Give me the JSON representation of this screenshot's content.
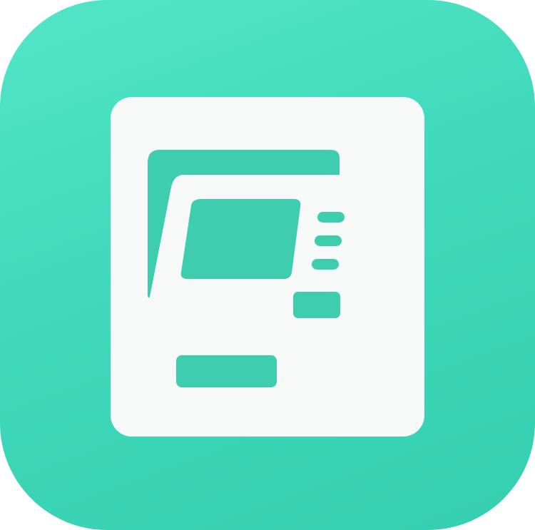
{
  "icon": {
    "name": "atm-machine-icon",
    "colors": {
      "background": "#43dcbd",
      "background_light": "#52e6c7",
      "background_dark": "#34cfb0",
      "foreground": "#f7f9f8",
      "accent": "#3cc7ab"
    }
  }
}
